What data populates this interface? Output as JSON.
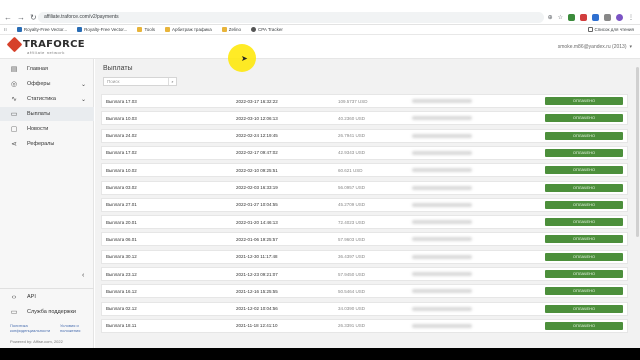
{
  "browser": {
    "url": "affiliate.traforce.com/v2/payments",
    "bookmarks": [
      {
        "label": "Royalty-Free Vector...",
        "color": "#2a6db5"
      },
      {
        "label": "Royalty-Free Vector...",
        "color": "#2a6db5"
      },
      {
        "label": "Tools",
        "color": "#e8b43a"
      },
      {
        "label": "Арбитраж трафика",
        "color": "#e8b43a"
      },
      {
        "label": "Zelino",
        "color": "#e8b43a"
      },
      {
        "label": "CPA Tracker",
        "color": "#555555"
      }
    ],
    "reading_list": "Список для чтения"
  },
  "header": {
    "logo_text": "TRAFORCE",
    "logo_sub": "affiliate network",
    "user_email": "smoke.m86@yandex.ru (2013)",
    "user_chevron": "▾"
  },
  "sidebar": {
    "items": [
      {
        "label": "Главная",
        "icon": "▤",
        "chevron": ""
      },
      {
        "label": "Офферы",
        "icon": "◎",
        "chevron": "⌄"
      },
      {
        "label": "Статистика",
        "icon": "∿",
        "chevron": "⌄"
      },
      {
        "label": "Выплаты",
        "icon": "▭",
        "chevron": ""
      },
      {
        "label": "Новости",
        "icon": "▢",
        "chevron": ""
      },
      {
        "label": "Рефералы",
        "icon": "⋖",
        "chevron": ""
      }
    ],
    "collapse_icon": "‹",
    "footer_items": [
      {
        "label": "API",
        "icon": "‹›"
      },
      {
        "label": "Служба поддержки",
        "icon": "▭"
      }
    ],
    "privacy_link": "Политика конфиденциальности",
    "terms_link": "Условия и положения",
    "powered": "Powered by: Affise.com, 2022"
  },
  "main": {
    "title": "Выплаты",
    "search_placeholder": "Поиск",
    "search_icon": "⌕",
    "status_color": "#4c8f3b",
    "rows": [
      {
        "name": "Выплата 17.03",
        "date": "2022-03-17 16:32:22",
        "amount": "109.5737 USD",
        "status": "ОПЛАЧЕНО"
      },
      {
        "name": "Выплата 10.03",
        "date": "2022-03-10 12:06:13",
        "amount": "40.2360 USD",
        "status": "ОПЛАЧЕНО"
      },
      {
        "name": "Выплата 24.02",
        "date": "2022-02-24 12:19:45",
        "amount": "26.7941 USD",
        "status": "ОПЛАЧЕНО"
      },
      {
        "name": "Выплата 17.02",
        "date": "2022-02-17 09:47:02",
        "amount": "42.9343 USD",
        "status": "ОПЛАЧЕНО"
      },
      {
        "name": "Выплата 10.02",
        "date": "2022-02-10 09:25:51",
        "amount": "60.621 USD",
        "status": "ОПЛАЧЕНО"
      },
      {
        "name": "Выплата 03.02",
        "date": "2022-02-03 16:33:19",
        "amount": "56.0957 USD",
        "status": "ОПЛАЧЕНО"
      },
      {
        "name": "Выплата 27.01",
        "date": "2022-01-27 10:04:55",
        "amount": "45.2709 USD",
        "status": "ОПЛАЧЕНО"
      },
      {
        "name": "Выплата 20.01",
        "date": "2022-01-20 14:46:13",
        "amount": "72.4023 USD",
        "status": "ОПЛАЧЕНО"
      },
      {
        "name": "Выплата 06.01",
        "date": "2022-01-06 19:25:57",
        "amount": "57.9603 USD",
        "status": "ОПЛАЧЕНО"
      },
      {
        "name": "Выплата 30.12",
        "date": "2021-12-30 11:17:48",
        "amount": "36.4397 USD",
        "status": "ОПЛАЧЕНО"
      },
      {
        "name": "Выплата 23.12",
        "date": "2021-12-23 09:21:07",
        "amount": "57.9450 USD",
        "status": "ОПЛАЧЕНО"
      },
      {
        "name": "Выплата 16.12",
        "date": "2021-12-16 15:25:55",
        "amount": "50.5464 USD",
        "status": "ОПЛАЧЕНО"
      },
      {
        "name": "Выплата 02.12",
        "date": "2021-12-02 10:04:56",
        "amount": "34.0390 USD",
        "status": "ОПЛАЧЕНО"
      },
      {
        "name": "Выплата 18.11",
        "date": "2021-11-18 12:41:10",
        "amount": "26.3391 USD",
        "status": "ОПЛАЧЕНО"
      }
    ]
  }
}
